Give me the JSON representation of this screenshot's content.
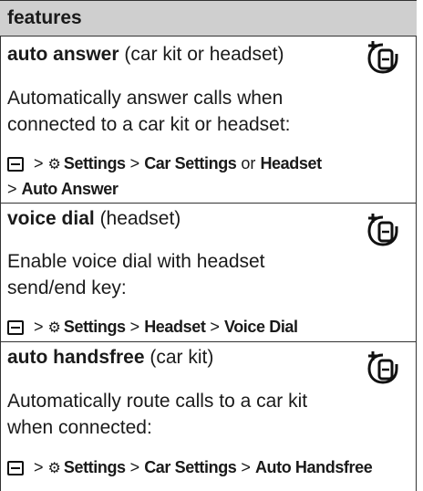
{
  "header": {
    "title": "features"
  },
  "sections": [
    {
      "title": "auto answer",
      "qualifier": "(car kit or headset)",
      "description_lines": [
        "Automatically answer calls when",
        "connected to a car kit or headset:"
      ],
      "path": {
        "settings": "Settings",
        "car_settings": "Car Settings",
        "or": "or",
        "headset": "Headset",
        "final": "Auto Answer"
      },
      "icon": "headset-icon"
    },
    {
      "title": "voice dial",
      "qualifier": "(headset)",
      "description_lines": [
        "Enable voice dial with headset",
        "send/end key:"
      ],
      "path": {
        "settings": "Settings",
        "headset": "Headset",
        "final": "Voice Dial"
      },
      "icon": "headset-icon"
    },
    {
      "title": "auto handsfree",
      "qualifier": "(car kit)",
      "description_lines": [
        "Automatically route calls to a car kit",
        "when connected:"
      ],
      "path": {
        "settings": "Settings",
        "car_settings": "Car Settings",
        "final": "Auto Handsfree"
      },
      "icon": "headset-icon"
    }
  ],
  "separator": ">",
  "icons": {
    "menu_key": "menu-key-icon",
    "settings": "settings-icon",
    "feature": "headset-icon"
  },
  "colors": {
    "header_bg": "#cfcfcf",
    "rule": "#333333"
  }
}
